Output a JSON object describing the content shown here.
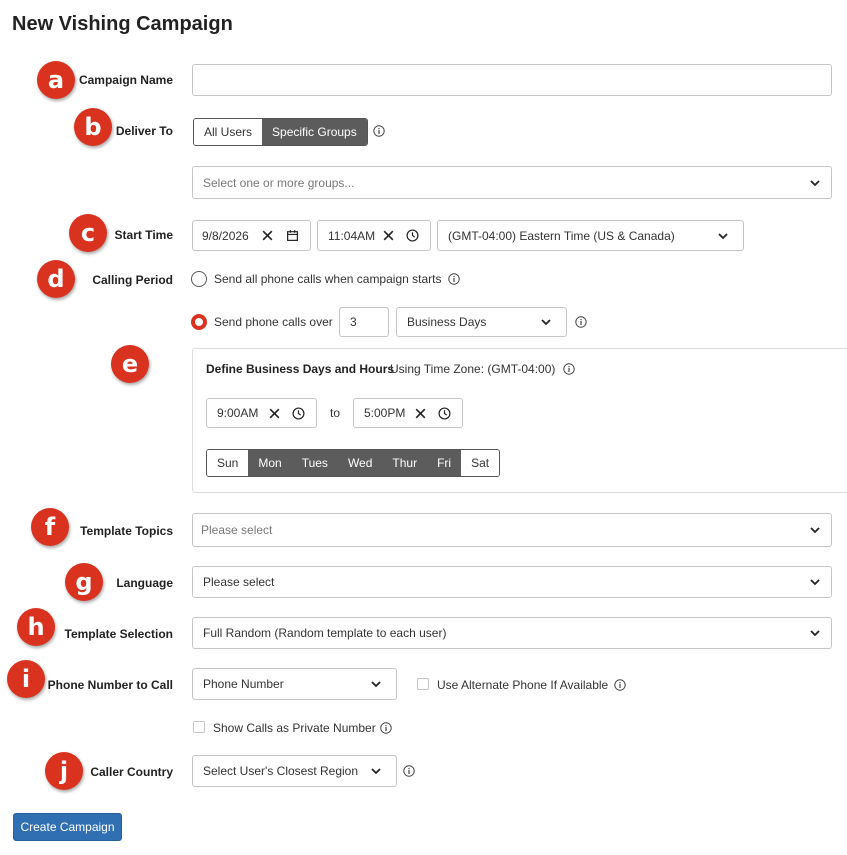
{
  "page": {
    "title": "New Vishing Campaign"
  },
  "badges": [
    "a",
    "b",
    "c",
    "d",
    "e",
    "f",
    "g",
    "h",
    "i",
    "j"
  ],
  "campaign_name": {
    "label": "Campaign Name",
    "value": ""
  },
  "deliver_to": {
    "label": "Deliver To",
    "options": [
      "All Users",
      "Specific Groups"
    ],
    "selected": "Specific Groups",
    "groups_placeholder": "Select one or more groups..."
  },
  "start_time": {
    "label": "Start Time",
    "date": "9/8/2026",
    "time": "11:04AM",
    "timezone": "(GMT-04:00) Eastern Time (US & Canada)"
  },
  "calling_period": {
    "label": "Calling Period",
    "option_all": "Send all phone calls when campaign starts",
    "option_over": "Send phone calls over",
    "over_count": "3",
    "over_unit": "Business Days",
    "selected": "over"
  },
  "business_hours": {
    "heading": "Define Business Days and Hours",
    "tz_note": "Using Time Zone: (GMT-04:00)",
    "from": "9:00AM",
    "to_label": "to",
    "to": "5:00PM",
    "days": [
      "Sun",
      "Mon",
      "Tues",
      "Wed",
      "Thur",
      "Fri",
      "Sat"
    ],
    "active_days": [
      "Mon",
      "Tues",
      "Wed",
      "Thur",
      "Fri"
    ]
  },
  "template_topics": {
    "label": "Template Topics",
    "placeholder": "Please select"
  },
  "language": {
    "label": "Language",
    "value": "Please select"
  },
  "template_selection": {
    "label": "Template Selection",
    "value": "Full Random (Random template to each user)"
  },
  "phone_number": {
    "label": "Phone Number to Call",
    "value": "Phone Number",
    "alt_phone_label": "Use Alternate Phone If Available",
    "private_label": "Show Calls as Private Number"
  },
  "caller_country": {
    "label": "Caller Country",
    "value": "Select User's Closest Region"
  },
  "submit": {
    "label": "Create Campaign"
  },
  "colors": {
    "badge": "#d9321f",
    "primary_button": "#2f6fb2",
    "segment_active": "#5c5c5c"
  }
}
